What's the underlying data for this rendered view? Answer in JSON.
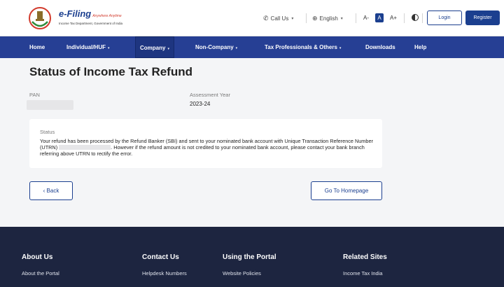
{
  "header": {
    "logo_title": "e-Filing",
    "logo_tagline": "Anywhere Anytime",
    "logo_sub": "Income Tax Department, Government of India",
    "call_us": "Call Us",
    "language": "English",
    "font_decrease": "A-",
    "font_default": "A",
    "font_increase": "A+",
    "login": "Login",
    "register": "Register"
  },
  "nav": {
    "items": [
      {
        "label": "Home",
        "dropdown": false
      },
      {
        "label": "Individual/HUF",
        "dropdown": true
      },
      {
        "label": "Company",
        "dropdown": true
      },
      {
        "label": "Non-Company",
        "dropdown": true
      },
      {
        "label": "Tax Professionals & Others",
        "dropdown": true
      },
      {
        "label": "Downloads",
        "dropdown": false
      },
      {
        "label": "Help",
        "dropdown": false
      }
    ],
    "chevron": "▾"
  },
  "main": {
    "title": "Status of Income Tax Refund",
    "pan_label": "PAN",
    "ay_label": "Assessment Year",
    "ay_value": "2023-24",
    "status_label": "Status",
    "status_text_1": "Your refund has been processed by the Refund Banker (SBI) and sent to your nominated bank account with Unique Transaction Reference Number (UTRN)",
    "status_text_2": ". However if the refund amount is not credited to your nominated bank account, please contact your bank branch referring above UTRN to rectify the error.",
    "back_button": "‹ Back",
    "home_button": "Go To Homepage"
  },
  "footer": {
    "columns": [
      {
        "heading": "About Us",
        "link": "About the Portal"
      },
      {
        "heading": "Contact Us",
        "link": "Helpdesk Numbers"
      },
      {
        "heading": "Using the Portal",
        "link": "Website Policies"
      },
      {
        "heading": "Related Sites",
        "link": "Income Tax India"
      }
    ]
  },
  "colors": {
    "brand_blue": "#1b3f8f",
    "nav_bg": "#263f94",
    "footer_bg": "#1d2540"
  }
}
